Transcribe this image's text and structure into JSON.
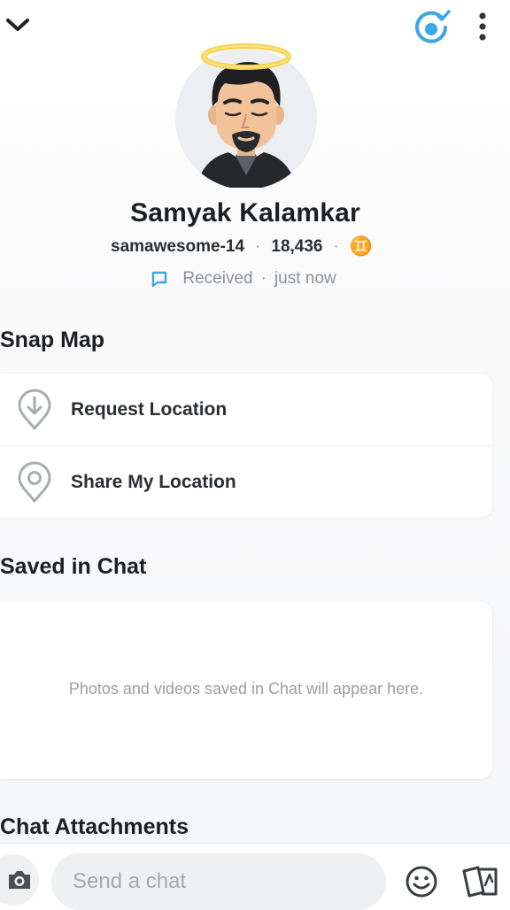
{
  "header": {
    "back_icon": "chevron-down-icon",
    "story_icon": "story-check-icon",
    "more_icon": "more-vertical-icon"
  },
  "profile": {
    "name": "Samyak Kalamkar",
    "username": "samawesome-14",
    "snap_score": "18,436",
    "zodiac": "♊",
    "separator": "·",
    "status_icon": "chat-bubble-icon",
    "status_text": "Received",
    "status_time": "just now"
  },
  "snap_map": {
    "title": "Snap Map",
    "items": [
      {
        "label": "Request Location",
        "icon": "request-location-icon"
      },
      {
        "label": "Share My Location",
        "icon": "location-pin-icon"
      }
    ]
  },
  "saved_in_chat": {
    "title": "Saved in Chat",
    "empty_text": "Photos and videos saved in Chat will appear here."
  },
  "chat_attachments": {
    "title": "Chat Attachments"
  },
  "bottom_bar": {
    "camera_icon": "camera-icon",
    "input_placeholder": "Send a chat",
    "emoji_icon": "emoji-icon",
    "sticker_icon": "sticker-icon"
  },
  "colors": {
    "accent_blue": "#3aa7e6",
    "halo_yellow": "#f6d34a",
    "text_dark": "#1c1f23",
    "text_muted": "#9a9fa4"
  }
}
